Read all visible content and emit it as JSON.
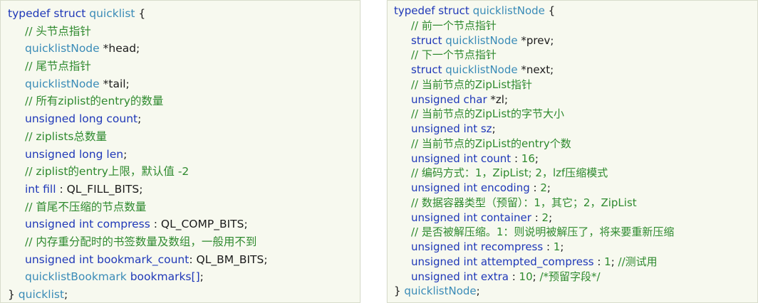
{
  "left_block": {
    "lines": [
      {
        "indent": false,
        "tokens": [
          {
            "c": "kw",
            "t": "typedef struct "
          },
          {
            "c": "ty",
            "t": "quicklist"
          },
          {
            "c": "tx",
            "t": " {"
          }
        ]
      },
      {
        "indent": true,
        "tokens": [
          {
            "c": "cm",
            "t": "// 头节点指针"
          }
        ]
      },
      {
        "indent": true,
        "tokens": [
          {
            "c": "ty",
            "t": "quicklistNode"
          },
          {
            "c": "tx",
            "t": " *head;"
          }
        ]
      },
      {
        "indent": true,
        "tokens": [
          {
            "c": "cm",
            "t": "// 尾节点指针"
          }
        ]
      },
      {
        "indent": true,
        "tokens": [
          {
            "c": "ty",
            "t": "quicklistNode"
          },
          {
            "c": "tx",
            "t": " *tail;"
          }
        ]
      },
      {
        "indent": true,
        "tokens": [
          {
            "c": "cm",
            "t": "// 所有ziplist的entry的数量"
          }
        ]
      },
      {
        "indent": true,
        "tokens": [
          {
            "c": "kw",
            "t": "unsigned long"
          },
          {
            "c": "tx",
            "t": " "
          },
          {
            "c": "kw",
            "t": "count"
          },
          {
            "c": "tx",
            "t": ";"
          }
        ]
      },
      {
        "indent": true,
        "tokens": [
          {
            "c": "cm",
            "t": "// ziplists总数量"
          }
        ]
      },
      {
        "indent": true,
        "tokens": [
          {
            "c": "kw",
            "t": "unsigned long"
          },
          {
            "c": "tx",
            "t": " "
          },
          {
            "c": "kw",
            "t": "len"
          },
          {
            "c": "tx",
            "t": ";"
          }
        ]
      },
      {
        "indent": true,
        "tokens": [
          {
            "c": "cm",
            "t": "// ziplist的entry上限，默认值 -2"
          }
        ]
      },
      {
        "indent": true,
        "tokens": [
          {
            "c": "kw",
            "t": "int fill"
          },
          {
            "c": "tx",
            "t": " : QL_FILL_BITS;"
          }
        ]
      },
      {
        "indent": true,
        "tokens": [
          {
            "c": "cm",
            "t": "// 首尾不压缩的节点数量"
          }
        ]
      },
      {
        "indent": true,
        "tokens": [
          {
            "c": "kw",
            "t": "unsigned int compress"
          },
          {
            "c": "tx",
            "t": " : QL_COMP_BITS;"
          }
        ]
      },
      {
        "indent": true,
        "tokens": [
          {
            "c": "cm",
            "t": "// 内存重分配时的书签数量及数组，一般用不到"
          }
        ]
      },
      {
        "indent": true,
        "tokens": [
          {
            "c": "kw",
            "t": "unsigned int bookmark_count"
          },
          {
            "c": "tx",
            "t": ": QL_BM_BITS;"
          }
        ]
      },
      {
        "indent": true,
        "tokens": [
          {
            "c": "ty",
            "t": "quicklistBookmark"
          },
          {
            "c": "tx",
            "t": " "
          },
          {
            "c": "kw",
            "t": "bookmarks"
          },
          {
            "c": "kw",
            "t": "[]"
          },
          {
            "c": "tx",
            "t": ";"
          }
        ]
      },
      {
        "indent": false,
        "tokens": [
          {
            "c": "tx",
            "t": "} "
          },
          {
            "c": "ty",
            "t": "quicklist"
          },
          {
            "c": "tx",
            "t": ";"
          }
        ]
      }
    ]
  },
  "right_block": {
    "lines": [
      {
        "indent": false,
        "tokens": [
          {
            "c": "kw",
            "t": "typedef struct "
          },
          {
            "c": "ty",
            "t": "quicklistNode"
          },
          {
            "c": "tx",
            "t": " {"
          }
        ]
      },
      {
        "indent": true,
        "tokens": [
          {
            "c": "cm",
            "t": "// 前一个节点指针"
          }
        ]
      },
      {
        "indent": true,
        "tokens": [
          {
            "c": "kw",
            "t": "struct "
          },
          {
            "c": "ty",
            "t": "quicklistNode"
          },
          {
            "c": "tx",
            "t": " *prev;"
          }
        ]
      },
      {
        "indent": true,
        "tokens": [
          {
            "c": "cm",
            "t": "// 下一个节点指针"
          }
        ]
      },
      {
        "indent": true,
        "tokens": [
          {
            "c": "kw",
            "t": "struct "
          },
          {
            "c": "ty",
            "t": "quicklistNode"
          },
          {
            "c": "tx",
            "t": " *next;"
          }
        ]
      },
      {
        "indent": true,
        "tokens": [
          {
            "c": "cm",
            "t": "// 当前节点的ZipList指针"
          }
        ]
      },
      {
        "indent": true,
        "tokens": [
          {
            "c": "kw",
            "t": "unsigned char"
          },
          {
            "c": "tx",
            "t": " *zl;"
          }
        ]
      },
      {
        "indent": true,
        "tokens": [
          {
            "c": "cm",
            "t": "// 当前节点的ZipList的字节大小"
          }
        ]
      },
      {
        "indent": true,
        "tokens": [
          {
            "c": "kw",
            "t": "unsigned int sz"
          },
          {
            "c": "tx",
            "t": ";"
          }
        ]
      },
      {
        "indent": true,
        "tokens": [
          {
            "c": "cm",
            "t": "// 当前节点的ZipList的entry个数"
          }
        ]
      },
      {
        "indent": true,
        "tokens": [
          {
            "c": "kw",
            "t": "unsigned int count"
          },
          {
            "c": "tx",
            "t": " : "
          },
          {
            "c": "nm",
            "t": "16"
          },
          {
            "c": "tx",
            "t": ";"
          }
        ]
      },
      {
        "indent": true,
        "tokens": [
          {
            "c": "cm",
            "t": "// 编码方式：1，ZipList; 2，lzf压缩模式"
          }
        ]
      },
      {
        "indent": true,
        "tokens": [
          {
            "c": "kw",
            "t": "unsigned int encoding"
          },
          {
            "c": "tx",
            "t": " : "
          },
          {
            "c": "nm",
            "t": "2"
          },
          {
            "c": "tx",
            "t": ";"
          }
        ]
      },
      {
        "indent": true,
        "tokens": [
          {
            "c": "cm",
            "t": "// 数据容器类型（预留）：1，其它；2，ZipList"
          }
        ]
      },
      {
        "indent": true,
        "tokens": [
          {
            "c": "kw",
            "t": "unsigned int container"
          },
          {
            "c": "tx",
            "t": " : "
          },
          {
            "c": "nm",
            "t": "2"
          },
          {
            "c": "tx",
            "t": ";"
          }
        ]
      },
      {
        "indent": true,
        "tokens": [
          {
            "c": "cm",
            "t": "// 是否被解压缩。1：则说明被解压了，将来要重新压缩"
          }
        ]
      },
      {
        "indent": true,
        "tokens": [
          {
            "c": "kw",
            "t": "unsigned int recompress"
          },
          {
            "c": "tx",
            "t": " : "
          },
          {
            "c": "nm",
            "t": "1"
          },
          {
            "c": "tx",
            "t": ";"
          }
        ]
      },
      {
        "indent": true,
        "tokens": [
          {
            "c": "kw",
            "t": "unsigned int attempted_compress"
          },
          {
            "c": "tx",
            "t": " : "
          },
          {
            "c": "nm",
            "t": "1"
          },
          {
            "c": "tx",
            "t": "; "
          },
          {
            "c": "cm",
            "t": "//测试用"
          }
        ]
      },
      {
        "indent": true,
        "tokens": [
          {
            "c": "kw",
            "t": "unsigned int extra"
          },
          {
            "c": "tx",
            "t": " : "
          },
          {
            "c": "nm",
            "t": "10"
          },
          {
            "c": "tx",
            "t": "; "
          },
          {
            "c": "cm",
            "t": "/*预留字段*/"
          }
        ]
      },
      {
        "indent": false,
        "tokens": [
          {
            "c": "tx",
            "t": "} "
          },
          {
            "c": "ty",
            "t": "quicklistNode"
          },
          {
            "c": "tx",
            "t": ";"
          }
        ]
      }
    ]
  }
}
